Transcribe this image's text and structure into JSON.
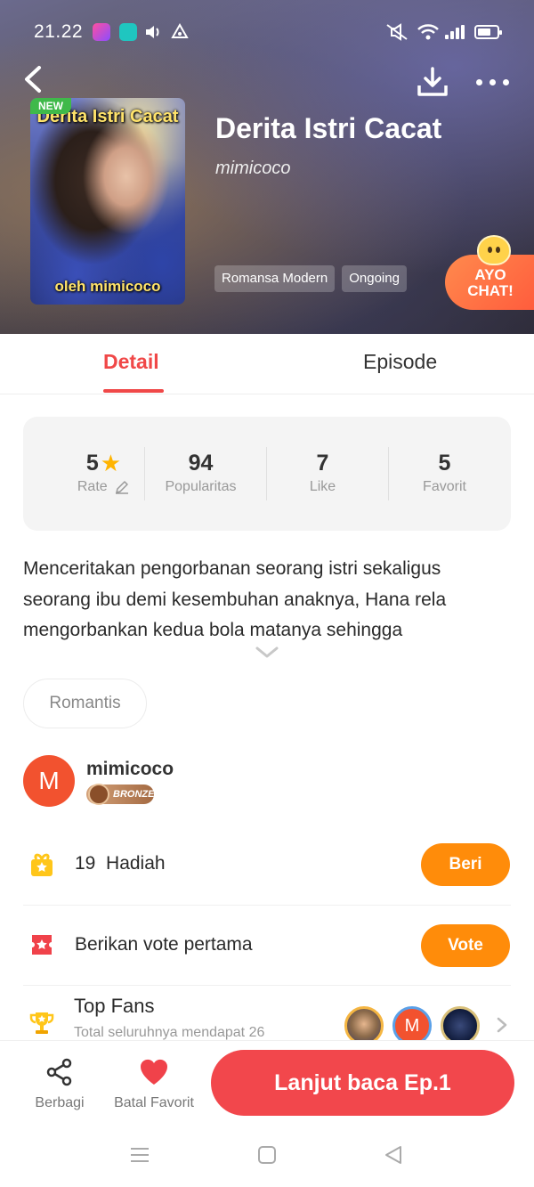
{
  "status_bar": {
    "time": "21.22"
  },
  "book": {
    "title": "Derita Istri Cacat",
    "author": "mimicoco",
    "cover_title": "Derita Istri Cacat",
    "cover_author": "oleh mimicoco",
    "badge": "NEW",
    "genres": [
      "Romansa Modern",
      "Ongoing"
    ]
  },
  "ayo_chat": {
    "line1": "AYO",
    "line2": "CHAT!"
  },
  "tabs": {
    "detail": "Detail",
    "episode": "Episode"
  },
  "stats": {
    "rate": {
      "value": "5",
      "label": "Rate"
    },
    "popularity": {
      "value": "94",
      "label": "Popularitas"
    },
    "like": {
      "value": "7",
      "label": "Like"
    },
    "favorite": {
      "value": "5",
      "label": "Favorit"
    }
  },
  "synopsis": "Menceritakan pengorbanan seorang istri sekaligus seorang ibu demi kesembuhan anaknya, Hana rela mengorbankan kedua bola matanya sehingga",
  "genre_chip": "Romantis",
  "author_section": {
    "avatar_letter": "M",
    "name": "mimicoco",
    "badge": "BRONZE"
  },
  "gifts": {
    "count": "19",
    "label": "Hadiah",
    "button": "Beri"
  },
  "vote": {
    "label": "Berikan vote pertama",
    "button": "Vote"
  },
  "top_fans": {
    "title": "Top Fans",
    "subtitle": "Total seluruhnya mendapat 26",
    "fan2_letter": "M"
  },
  "bottom_bar": {
    "share": "Berbagi",
    "unfavorite": "Batal Favorit",
    "read": "Lanjut baca Ep.1"
  },
  "colors": {
    "accent": "#f04848",
    "orange": "#ff8c0a",
    "read_button": "#f2474c"
  }
}
